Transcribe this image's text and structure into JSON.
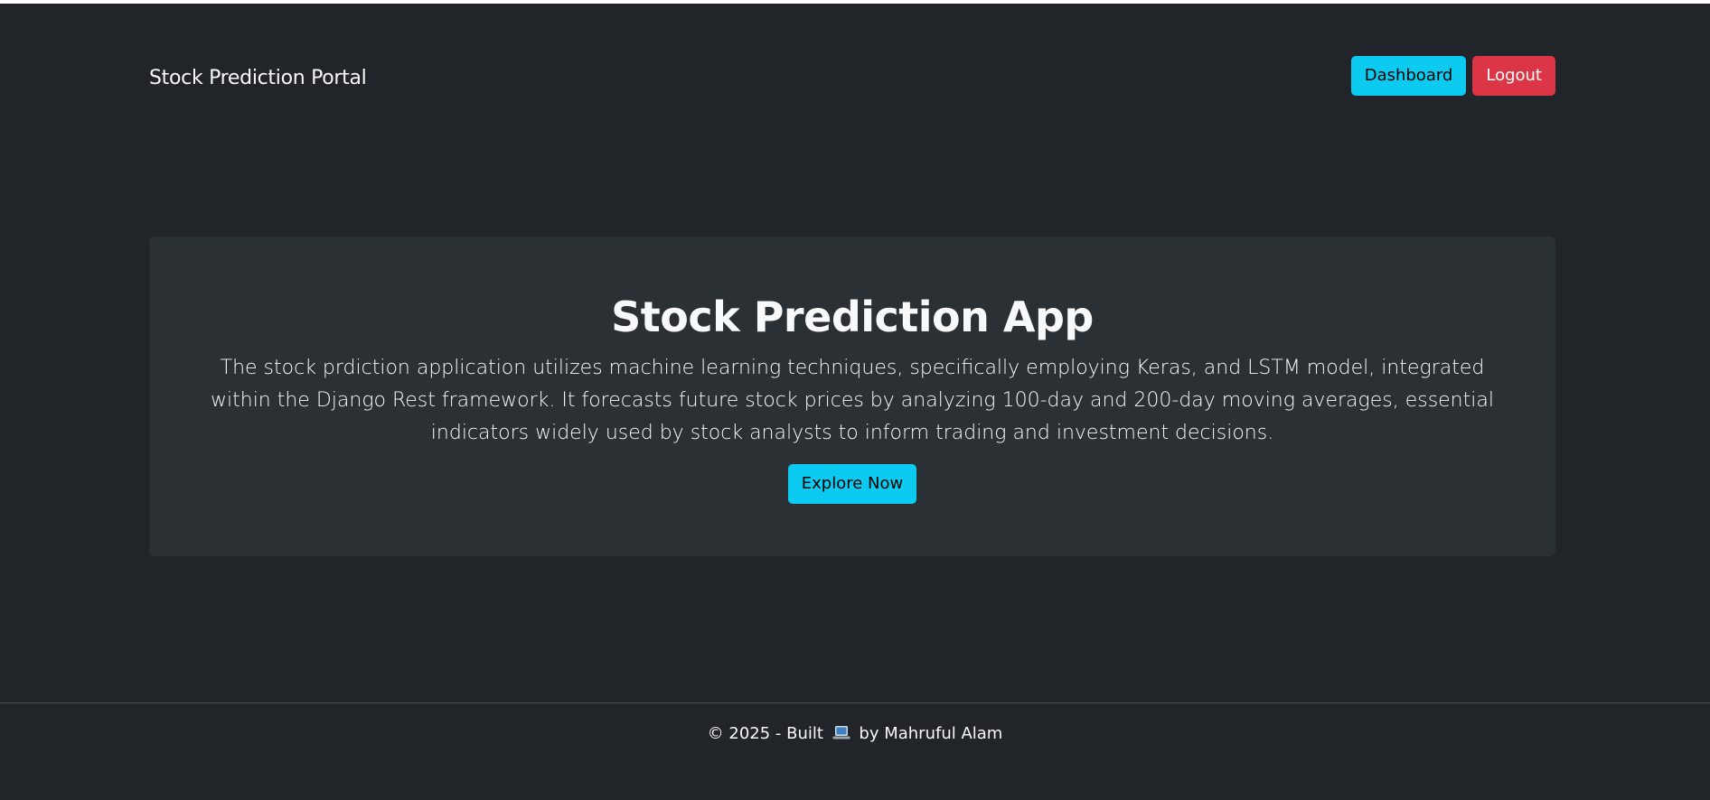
{
  "navbar": {
    "brand": "Stock Prediction Portal",
    "dashboard_label": "Dashboard",
    "logout_label": "Logout"
  },
  "hero": {
    "title": "Stock Prediction App",
    "description": "The stock prdiction application utilizes machine learning techniques, specifically employing Keras, and LSTM model, integrated within the Django Rest framework. It forecasts future stock prices by analyzing 100-day and 200-day moving averages, essential indicators widely used by stock analysts to inform trading and investment decisions.",
    "cta_label": "Explore Now"
  },
  "footer": {
    "prefix": "© 2025 - Built",
    "icon": "laptop-icon",
    "suffix": "by Mahruful Alam"
  },
  "colors": {
    "background": "#212529",
    "hero_background": "#2b3035",
    "info": "#0dcaf0",
    "danger": "#dc3545"
  }
}
